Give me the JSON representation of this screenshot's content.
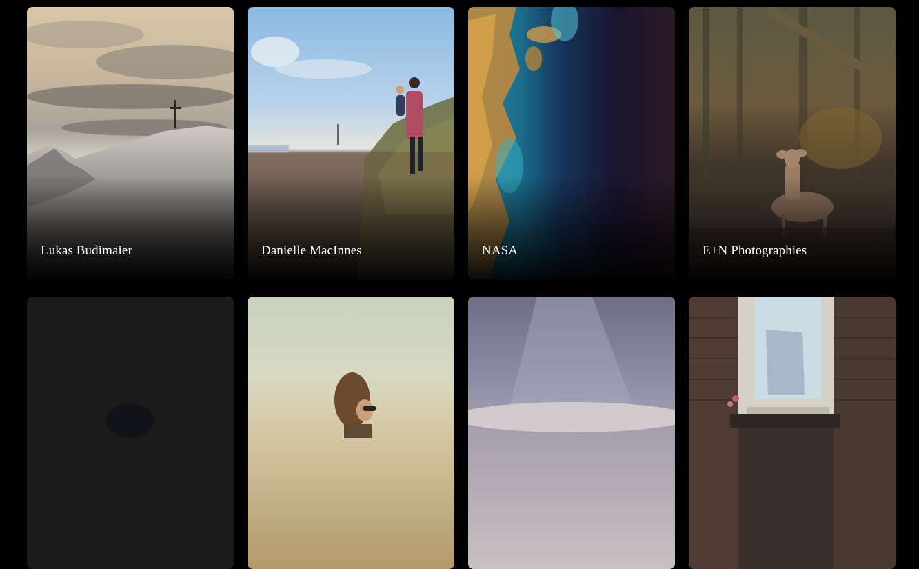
{
  "gallery": {
    "cards": [
      {
        "author": "Lukas Budimaier"
      },
      {
        "author": "Danielle MacInnes"
      },
      {
        "author": "NASA"
      },
      {
        "author": "E+N Photographies"
      },
      {
        "author": ""
      },
      {
        "author": ""
      },
      {
        "author": ""
      },
      {
        "author": ""
      }
    ]
  }
}
